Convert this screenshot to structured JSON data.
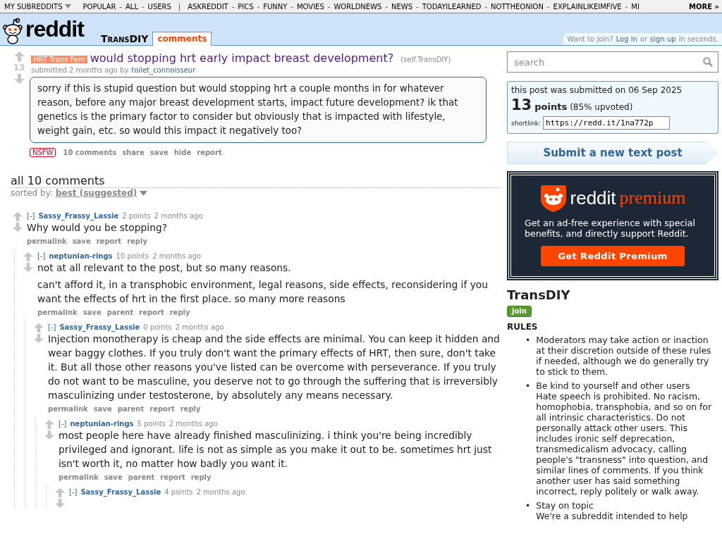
{
  "topbar": {
    "menu": "MY SUBREDDITS",
    "separator": "-",
    "group_separator": "|",
    "groups": [
      [
        "POPULAR",
        "ALL",
        "USERS"
      ],
      [
        "ASKREDDIT",
        "PICS",
        "FUNNY",
        "MOVIES",
        "WORLDNEWS",
        "NEWS",
        "TODAYILEARNED",
        "NOTTHEONION",
        "EXPLAINLIKEIMFIVE",
        "MI"
      ]
    ],
    "more": "MORE »"
  },
  "header": {
    "logo": "reddit",
    "subreddit": "TransDIY",
    "tabs": [
      {
        "label": "comments",
        "selected": true
      }
    ],
    "login": {
      "prompt": "Want to join?",
      "login": "Log in",
      "or": "or",
      "signup": "sign up",
      "suffix": "in seconds."
    }
  },
  "post": {
    "score": "13",
    "flair": "HRT Trans Fem",
    "title": "would stopping hrt early impact breast development?",
    "domain": "(self.TransDIY)",
    "tagline": "submitted 2 months ago by",
    "author": "toilet_connoisseur",
    "body": "sorry if this is stupid question but would stopping hrt a couple months in for whatever reason, before any major breast development starts, impact future development? ik that genetics is the primary factor to consider but obviously that is impacted with lifestyle, weight gain, etc. so would this impact it negatively too?",
    "nsfw": "NSFW",
    "buttons": [
      "10 comments",
      "share",
      "save",
      "hide",
      "report"
    ]
  },
  "comments_area": {
    "heading": "all 10 comments",
    "sort_label": "sorted by:",
    "sort_value": "best (suggested)",
    "comments": [
      {
        "toggle": "[-]",
        "author": "Sassy_Frassy_Lassie",
        "score": "2 points",
        "time": "2 months ago",
        "paragraphs": [
          "Why would you be stopping?"
        ],
        "actions": [
          "permalink",
          "save",
          "report",
          "reply"
        ],
        "children": [
          {
            "toggle": "[-]",
            "author": "neptunian-rings",
            "score": "10 points",
            "time": "2 months ago",
            "paragraphs": [
              "not at all relevant to the post, but so many reasons.",
              "can't afford it, in a transphobic environment, legal reasons, side effects, reconsidering if you want the effects of hrt in the first place. so many more reasons"
            ],
            "actions": [
              "permalink",
              "save",
              "parent",
              "report",
              "reply"
            ],
            "children": [
              {
                "toggle": "[-]",
                "author": "Sassy_Frassy_Lassie",
                "score": "0 points",
                "time": "2 months ago",
                "paragraphs": [
                  "Injection monotherapy is cheap and the side effects are minimal. You can keep it hidden and wear baggy clothes. If you truly don't want the primary effects of HRT, then sure, don't take it. But all those other reasons you've listed can be overcome with perseverance. If you truly do not want to be masculine, you deserve not to go through the suffering that is irreversibly masculinizing under testosterone, by absolutely any means necessary."
                ],
                "actions": [
                  "permalink",
                  "save",
                  "parent",
                  "report",
                  "reply"
                ],
                "children": [
                  {
                    "toggle": "[-]",
                    "author": "neptunian-rings",
                    "score": "5 points",
                    "time": "2 months ago",
                    "paragraphs": [
                      "most people here have already finished masculinizing. i think you're being incredibly privileged and ignorant. life is not as simple as you make it out to be. sometimes hrt just isn't worth it, no matter how badly you want it."
                    ],
                    "actions": [
                      "permalink",
                      "save",
                      "parent",
                      "report",
                      "reply"
                    ],
                    "children": [
                      {
                        "toggle": "[-]",
                        "author": "Sassy_Frassy_Lassie",
                        "score": "4 points",
                        "time": "2 months ago"
                      }
                    ]
                  }
                ]
              }
            ]
          }
        ]
      }
    ]
  },
  "sidebar": {
    "search": {
      "placeholder": "search"
    },
    "info": {
      "submitted": "this post was submitted on 06 Sep 2025",
      "points": "13",
      "points_label": "points",
      "upvoted": "(85% upvoted)",
      "shortlink_label": "shortlink:",
      "shortlink": "https://redd.it/1na772p"
    },
    "submit": "Submit a new text post",
    "premium": {
      "brand": "reddit",
      "product": "premium",
      "text": "Get an ad-free experience with special benefits, and directly support Reddit.",
      "button": "Get Reddit Premium"
    },
    "subreddit": {
      "title": "TransDIY",
      "join": "join",
      "rules_heading": "RULES",
      "rules": [
        {
          "bullet": "•",
          "text": "Moderators may take action or inaction at their discretion outside of these rules if needed, although we do generally try to stick to them."
        },
        {
          "bullet": "•",
          "title": "Be kind to yourself and other users",
          "text": "Hate speech is prohibited. No racism, homophobia, transphobia, and so on for all intrinsic characteristics. Do not personally attack other users. This includes ironic self deprecation, transmedicalism advocacy, calling people's \"transness\" into question, and similar lines of comments. If you think another user has said something incorrect, reply politely or walk away."
        },
        {
          "bullet": "•",
          "title": "Stay on topic",
          "text": "We're a subreddit intended to help"
        }
      ]
    }
  }
}
